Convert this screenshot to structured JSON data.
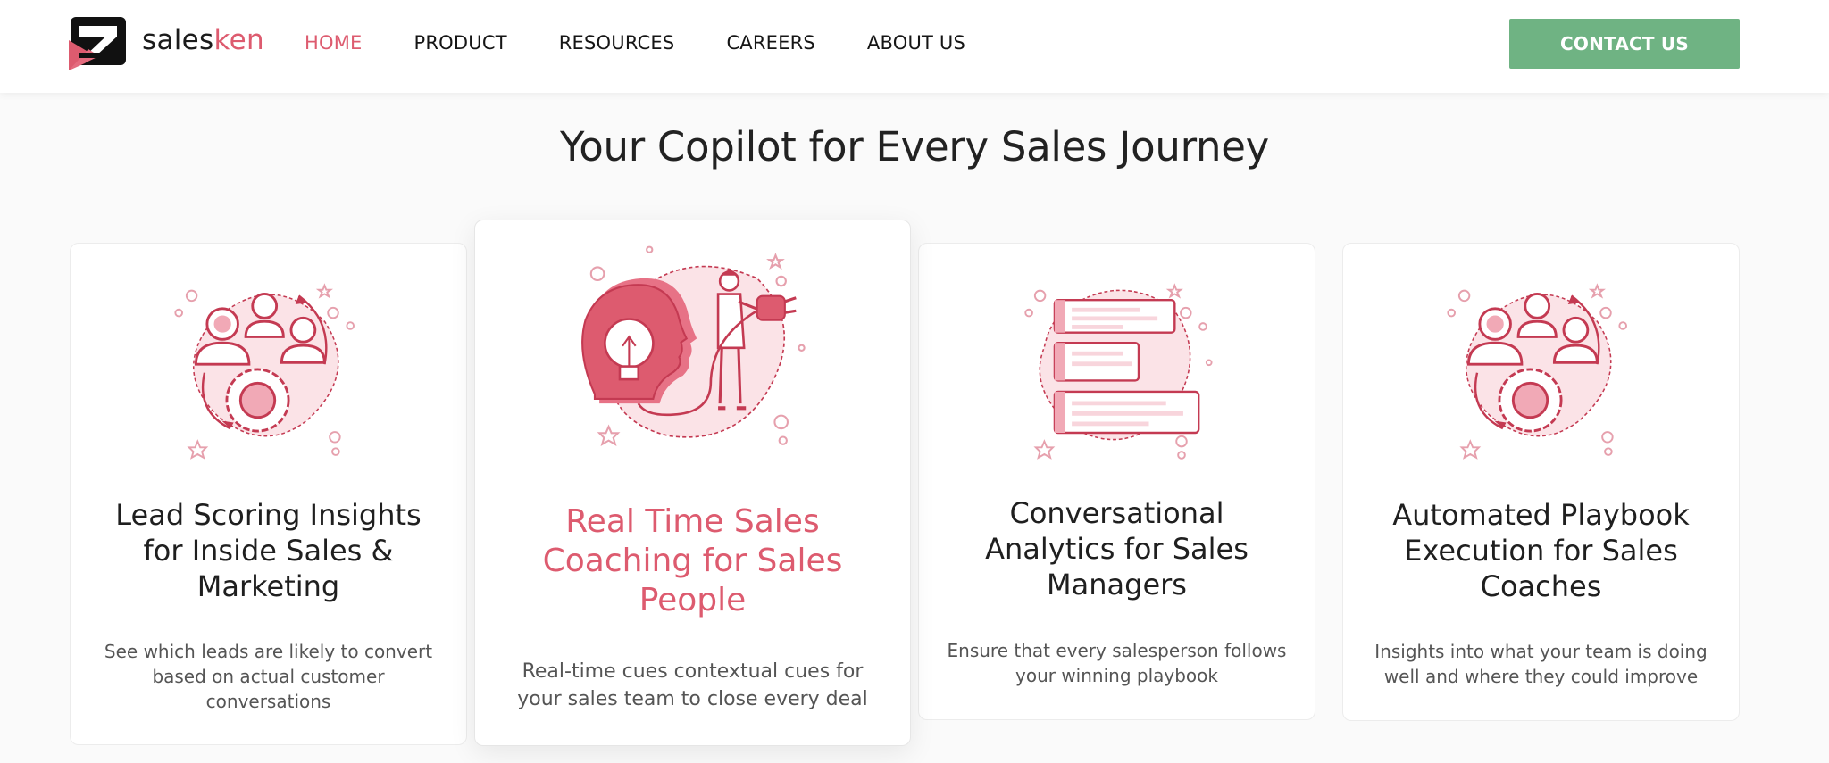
{
  "brand": {
    "name_prefix": "sales",
    "name_suffix": "ken",
    "accent": "#dd5b6f",
    "cta_color": "#6fb383"
  },
  "nav": {
    "items": [
      {
        "label": "HOME",
        "active": true
      },
      {
        "label": "PRODUCT"
      },
      {
        "label": "RESOURCES"
      },
      {
        "label": "CAREERS"
      },
      {
        "label": "ABOUT US"
      }
    ],
    "cta_label": "CONTACT US"
  },
  "section": {
    "title": "Your Copilot for Every Sales Journey"
  },
  "cards": [
    {
      "title": "Lead Scoring Insights for Inside Sales & Marketing",
      "description": "See which leads are likely to convert based on actual customer conversations",
      "icon": "people-gear-illustration"
    },
    {
      "title": "Real Time Sales Coaching for Sales People",
      "description": "Real-time cues contextual cues for your sales team to close every deal",
      "icon": "head-lightbulb-plug-illustration",
      "featured": true
    },
    {
      "title": "Conversational Analytics for Sales Managers",
      "description": "Ensure that every salesperson follows your winning playbook",
      "icon": "stacked-bars-illustration"
    },
    {
      "title": "Automated Playbook Execution for Sales Coaches",
      "description": "Insights into what your team is doing well and where they could improve",
      "icon": "people-gear-illustration"
    }
  ]
}
